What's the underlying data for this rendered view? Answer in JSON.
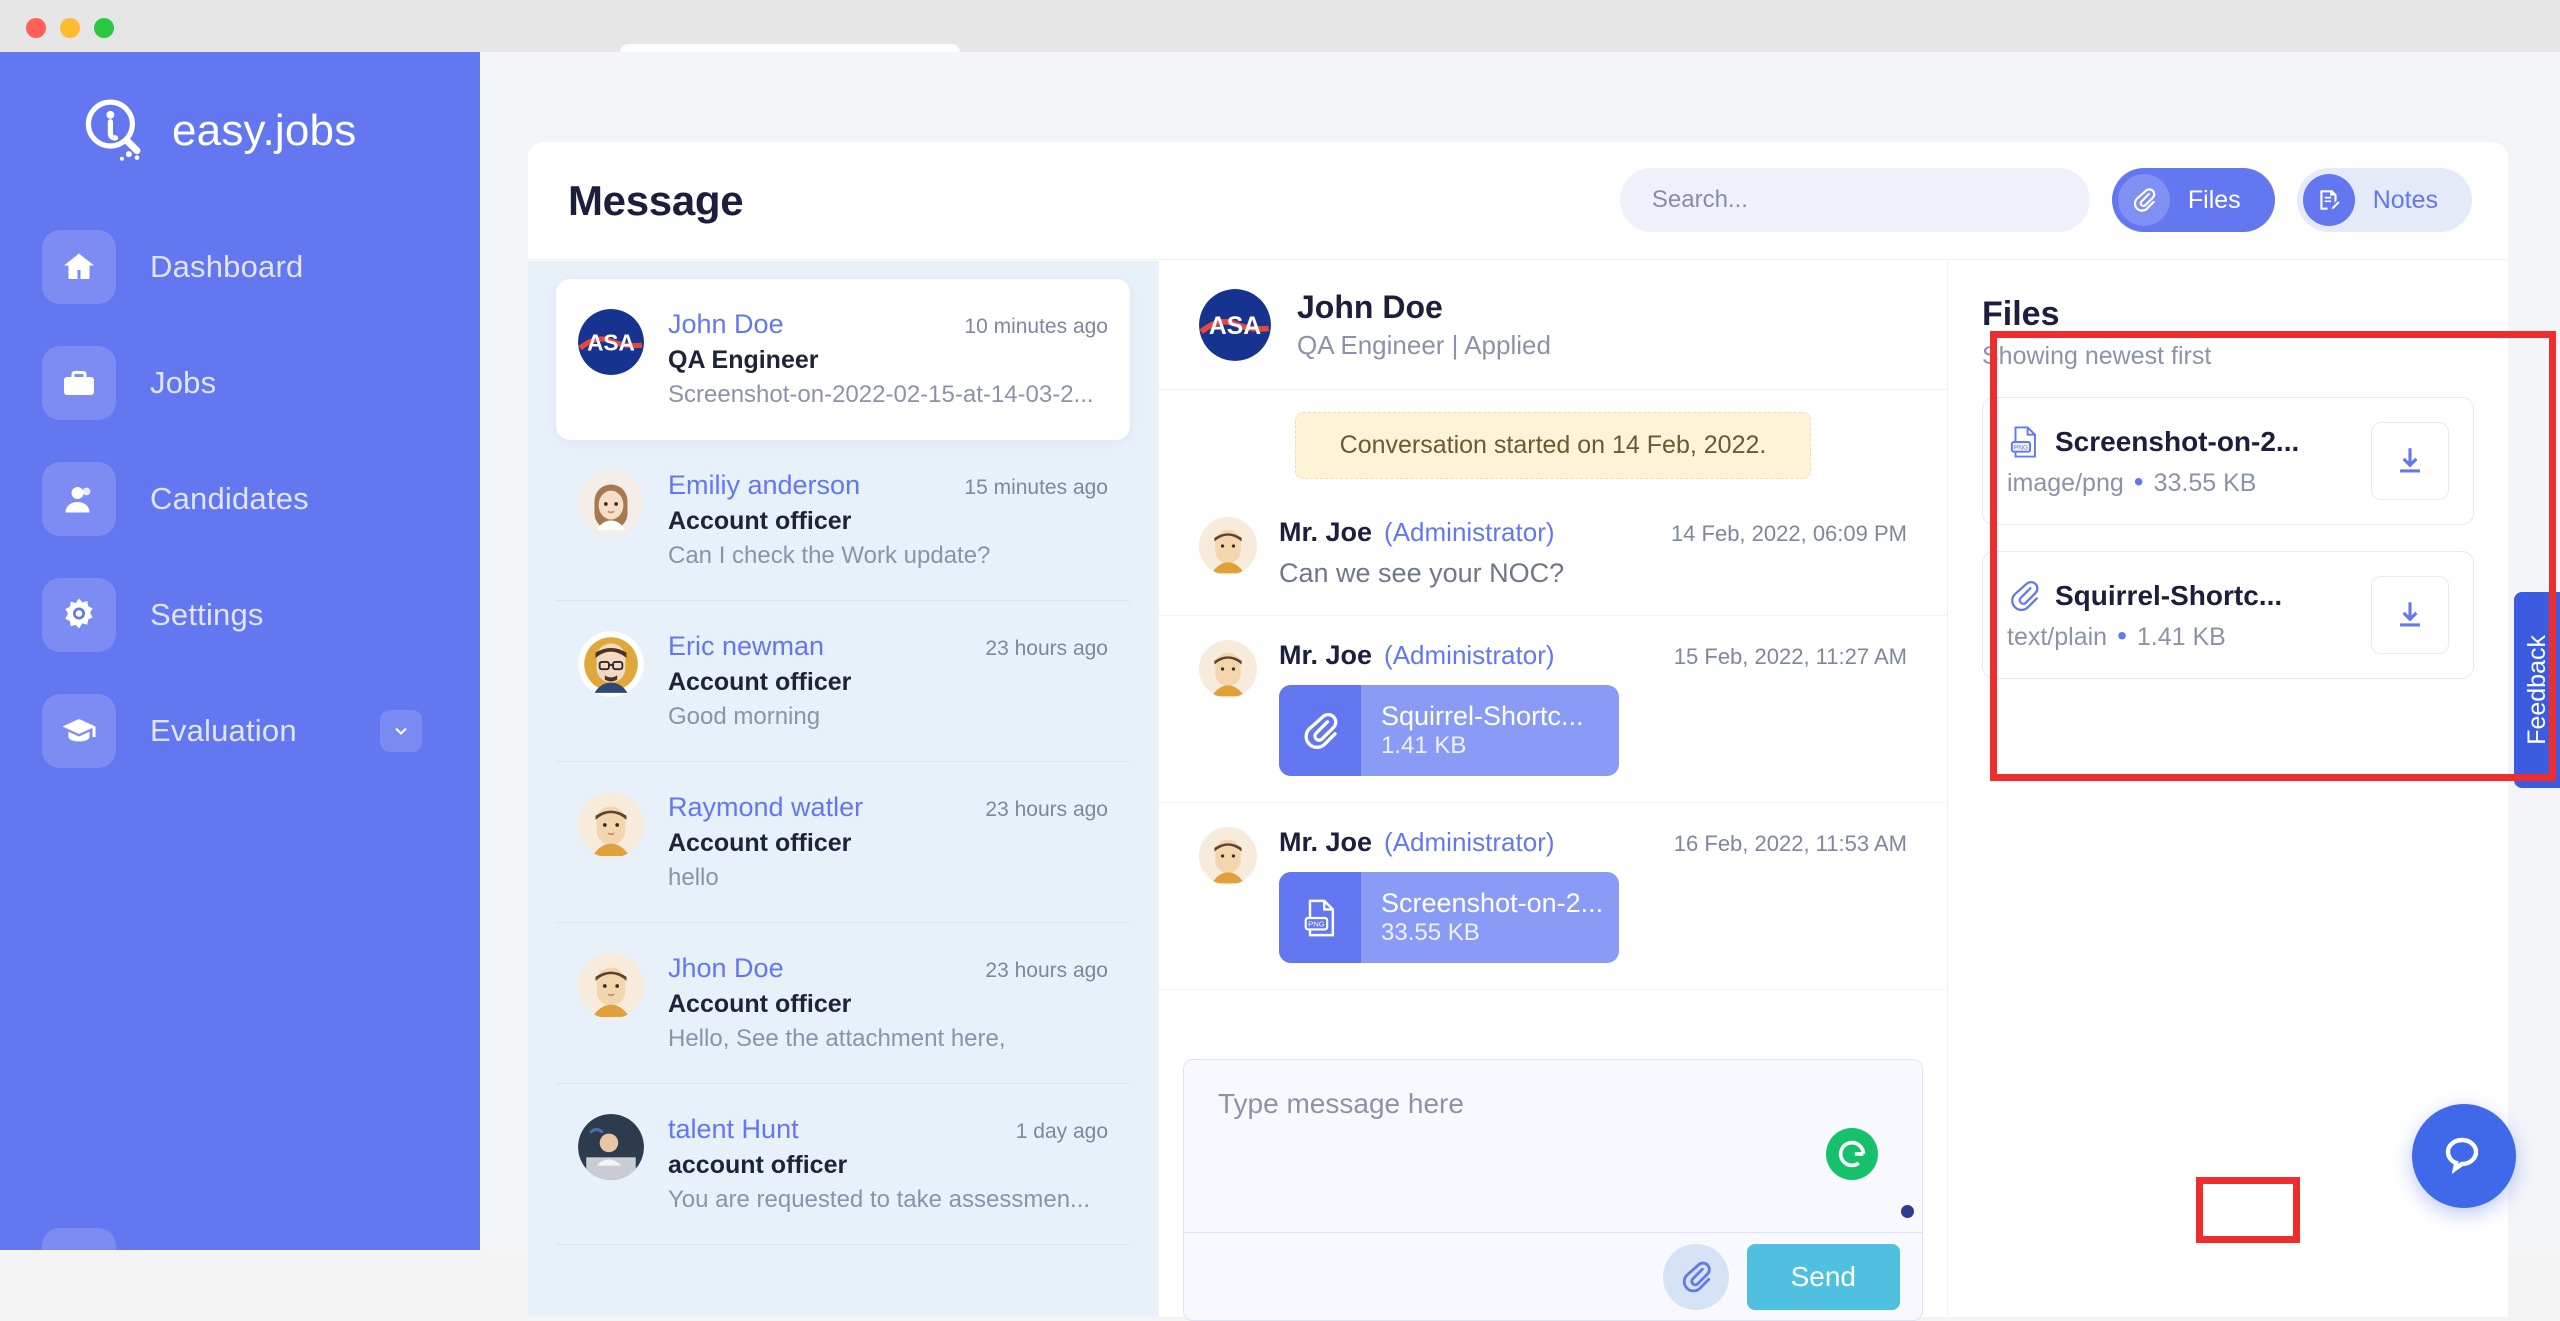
{
  "window": {
    "traffic_lights": [
      "close",
      "minimize",
      "zoom"
    ]
  },
  "brand": {
    "name": "easy.jobs",
    "logo_icon": "magnifier-person-icon"
  },
  "sidebar": {
    "items": [
      {
        "label": "Dashboard",
        "icon": "home-icon",
        "has_chevron": false
      },
      {
        "label": "Jobs",
        "icon": "briefcase-icon",
        "has_chevron": false
      },
      {
        "label": "Candidates",
        "icon": "user-icon",
        "has_chevron": false
      },
      {
        "label": "Settings",
        "icon": "gear-icon",
        "has_chevron": false
      },
      {
        "label": "Evaluation",
        "icon": "graduation-cap-icon",
        "has_chevron": true
      }
    ]
  },
  "header": {
    "title": "Message",
    "search": {
      "placeholder": "Search...",
      "value": ""
    },
    "files_button": {
      "label": "Files",
      "icon": "paperclip-icon",
      "active": true
    },
    "notes_button": {
      "label": "Notes",
      "icon": "note-edit-icon",
      "active": false
    }
  },
  "conversations": [
    {
      "name": "John Doe",
      "time": "10 minutes ago",
      "role": "QA Engineer",
      "snippet": "Screenshot-on-2022-02-15-at-14-03-2...",
      "avatar": "nasa-logo-avatar",
      "active": true
    },
    {
      "name": "Emiliy anderson",
      "time": "15 minutes ago",
      "role": "Account officer",
      "snippet": "Can I check the Work update?",
      "avatar": "woman-avatar",
      "active": false
    },
    {
      "name": "Eric newman",
      "time": "23 hours ago",
      "role": "Account officer",
      "snippet": "Good morning",
      "avatar": "man-glasses-avatar",
      "active": false
    },
    {
      "name": "Raymond watler",
      "time": "23 hours ago",
      "role": "Account officer",
      "snippet": "hello",
      "avatar": "man-orange-avatar",
      "active": false
    },
    {
      "name": "Jhon Doe",
      "time": "23 hours ago",
      "role": "Account officer",
      "snippet": "Hello, See the attachment here,",
      "avatar": "man-orange-avatar",
      "active": false
    },
    {
      "name": "talent Hunt",
      "time": "1 day ago",
      "role": "account officer",
      "snippet": "You are requested to take assessmen...",
      "avatar": "photo-avatar",
      "active": false
    }
  ],
  "chat": {
    "header": {
      "name": "John Doe",
      "subtitle": "QA Engineer | Applied",
      "avatar": "nasa-logo-avatar"
    },
    "conversation_started": "Conversation started on 14 Feb, 2022.",
    "messages": [
      {
        "author": "Mr. Joe",
        "role": "(Administrator)",
        "time": "14 Feb, 2022, 06:09 PM",
        "text": "Can we see your NOC?",
        "attachment": null
      },
      {
        "author": "Mr. Joe",
        "role": "(Administrator)",
        "time": "15 Feb, 2022, 11:27 AM",
        "text": "",
        "attachment": {
          "name": "Squirrel-Shortc...",
          "size": "1.41 KB",
          "icon": "paperclip-icon"
        }
      },
      {
        "author": "Mr. Joe",
        "role": "(Administrator)",
        "time": "16 Feb, 2022, 11:53 AM",
        "text": "",
        "attachment": {
          "name": "Screenshot-on-2...",
          "size": "33.55 KB",
          "icon": "png-file-icon"
        }
      }
    ],
    "composer": {
      "placeholder": "Type message here",
      "value": "",
      "grammarly_icon": "grammarly-icon",
      "attach_icon": "paperclip-icon",
      "send_label": "Send"
    }
  },
  "files_panel": {
    "title": "Files",
    "subtitle": "Showing newest first",
    "items": [
      {
        "name": "Screenshot-on-2...",
        "mime": "image/png",
        "size": "33.55 KB",
        "type_icon": "png-file-icon",
        "download_icon": "download-icon"
      },
      {
        "name": "Squirrel-Shortc...",
        "mime": "text/plain",
        "size": "1.41 KB",
        "type_icon": "paperclip-icon",
        "download_icon": "download-icon"
      }
    ]
  },
  "floating": {
    "feedback_label": "Feedback",
    "help_icon": "chat-bubble-icon"
  },
  "colors": {
    "brand_blue": "#6377f0",
    "sidebar_blue": "#6377f0",
    "list_bg": "#e8f0f9",
    "send_blue": "#4fc0e0",
    "grammarly_green": "#15c26b",
    "feedback_blue": "#3b5ce0",
    "highlight_red": "#f02d2d",
    "banner_yellow": "#fdf3d7"
  }
}
